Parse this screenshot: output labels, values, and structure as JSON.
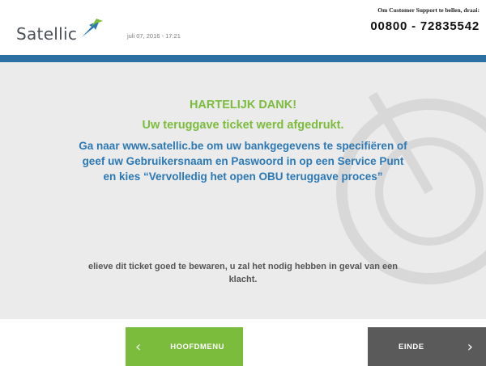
{
  "header": {
    "logo_text": "Satellic",
    "datetime": "juli 07, 2016 - 17:21",
    "support_label": "Om Customer Support te bellen, draai:",
    "support_phone": "00800 - 72835542"
  },
  "message": {
    "title": "HARTELIJK DANK!",
    "subtitle": "Uw teruggave ticket werd afgedrukt.",
    "line1": "Ga naar www.satellic.be om uw bankgegevens te specifiëren of",
    "line2": "geef uw Gebruikersnaam en Paswoord in op een Service Punt",
    "line3": "en kies “Vervolledig het open OBU teruggave proces”",
    "note_line1": "elieve dit ticket goed te bewaren, u zal het nodig hebben in geval van een",
    "note_line2": "klacht."
  },
  "footer": {
    "home_label": "HOOFDMENU",
    "end_label": "EINDE"
  },
  "colors": {
    "accent_green": "#7cbc3d",
    "brand_blue": "#2c6fa3",
    "text_blue": "#2b78b4",
    "end_button": "#5a5a5a"
  },
  "icons": {
    "logo": "satellic-arrow-logo-icon",
    "home_chevron": "chevron-left-icon",
    "end_chevron": "chevron-right-icon"
  }
}
